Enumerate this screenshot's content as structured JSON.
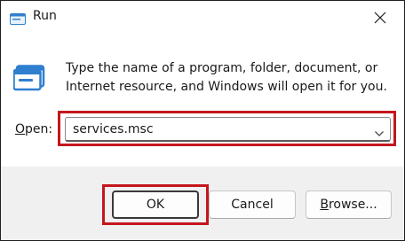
{
  "window": {
    "title": "Run",
    "title_icon": "run-dialog-icon",
    "close_icon": "close-icon"
  },
  "content": {
    "app_icon": "run-dialog-icon",
    "description": "Type the name of a program, folder, document, or Internet resource, and Windows will open it for you."
  },
  "open_field": {
    "label_mnemonic": "O",
    "label_rest": "pen:",
    "value": "services.msc",
    "dropdown_icon": "chevron-down-icon"
  },
  "buttons": {
    "ok": "OK",
    "cancel": "Cancel",
    "browse_mnemonic": "B",
    "browse_rest": "rowse..."
  },
  "colors": {
    "highlight": "#c4161c",
    "accent": "#0067c0",
    "footer_bg": "#f0f0f0"
  }
}
